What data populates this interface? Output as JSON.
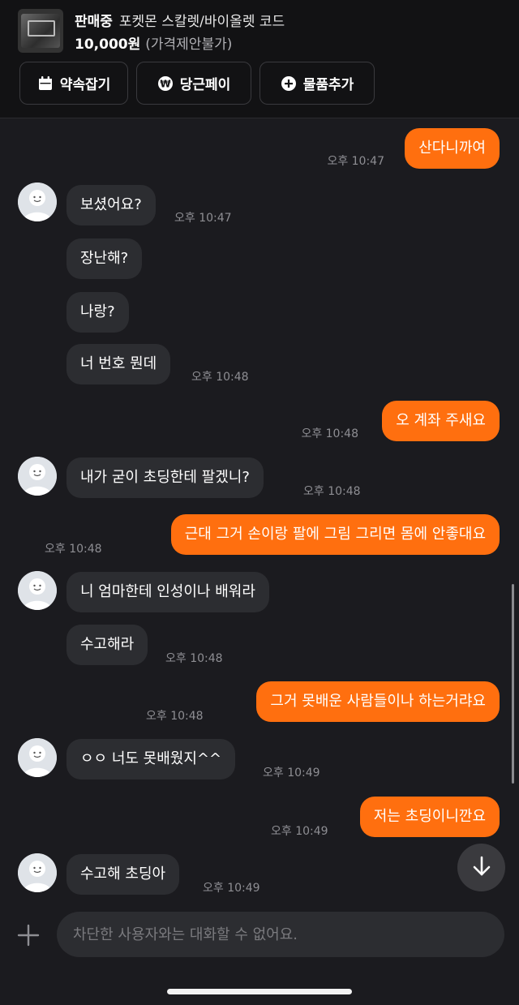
{
  "product": {
    "status": "판매중",
    "name": "포켓몬 스칼렛/바이올렛 코드",
    "price": "10,000원",
    "negotiation": "(가격제안불가)"
  },
  "actions": [
    {
      "label": "약속잡기",
      "icon": "calendar-icon"
    },
    {
      "label": "당근페이",
      "icon": "won-circle-icon"
    },
    {
      "label": "물품추가",
      "icon": "plus-circle-icon"
    }
  ],
  "messages": [
    {
      "side": "out",
      "text": "산다니까여",
      "time": "오후 10:47"
    },
    {
      "side": "in",
      "text": "보셨어요?",
      "time": "오후 10:47",
      "avatar": true
    },
    {
      "side": "in",
      "text": "장난해?"
    },
    {
      "side": "in",
      "text": "나랑?"
    },
    {
      "side": "in",
      "text": "너 번호 뭔데",
      "time": "오후 10:48"
    },
    {
      "side": "out",
      "text": "오 계좌 주새요",
      "time": "오후 10:48"
    },
    {
      "side": "in",
      "text": "내가 굳이 초딩한테 팔겠니?",
      "time": "오후 10:48",
      "avatar": true
    },
    {
      "side": "out",
      "text": "근대 그거 손이랑 팔에 그림 그리면 몸에 안좋대요",
      "time": "오후 10:48"
    },
    {
      "side": "in",
      "text": "니 엄마한테 인성이나 배워라",
      "avatar": true
    },
    {
      "side": "in",
      "text": "수고해라",
      "time": "오후 10:48"
    },
    {
      "side": "out",
      "text": "그거 못배운 사람들이나 하는거랴요",
      "time": "오후 10:48"
    },
    {
      "side": "in",
      "text": "ㅇㅇ 너도 못배웠지^^",
      "time": "오후 10:49",
      "avatar": true
    },
    {
      "side": "out",
      "text": "저는 초딩이니깐요",
      "time": "오후 10:49"
    },
    {
      "side": "in",
      "text": "수고해 초딩아",
      "time": "오후 10:49",
      "avatar": true
    }
  ],
  "composer": {
    "placeholder": "차단한 사용자와는 대화할 수 없어요."
  },
  "icons": {
    "scroll_down": "arrow-down-icon",
    "attach": "plus-icon"
  },
  "colors": {
    "accent": "#ff6f0f",
    "background": "#1b1b1f",
    "header": "#121214",
    "incoming_bubble": "#2c2d31"
  }
}
